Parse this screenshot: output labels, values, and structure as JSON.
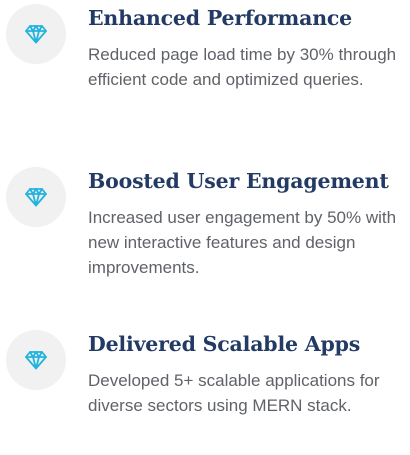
{
  "colors": {
    "title": "#223a64",
    "description": "#5f6268",
    "icon_background": "#f1f1f1",
    "icon": "#22b3dd"
  },
  "items": [
    {
      "icon": "diamond-icon",
      "title": "Enhanced Performance",
      "description": "Reduced page load time by 30% through efficient code and optimized queries."
    },
    {
      "icon": "diamond-icon",
      "title": "Boosted User Engagement",
      "description": "Increased user engagement by 50% with new interactive features and design improvements."
    },
    {
      "icon": "diamond-icon",
      "title": "Delivered Scalable Apps",
      "description": "Developed 5+ scalable applications for diverse sectors using MERN stack."
    }
  ]
}
